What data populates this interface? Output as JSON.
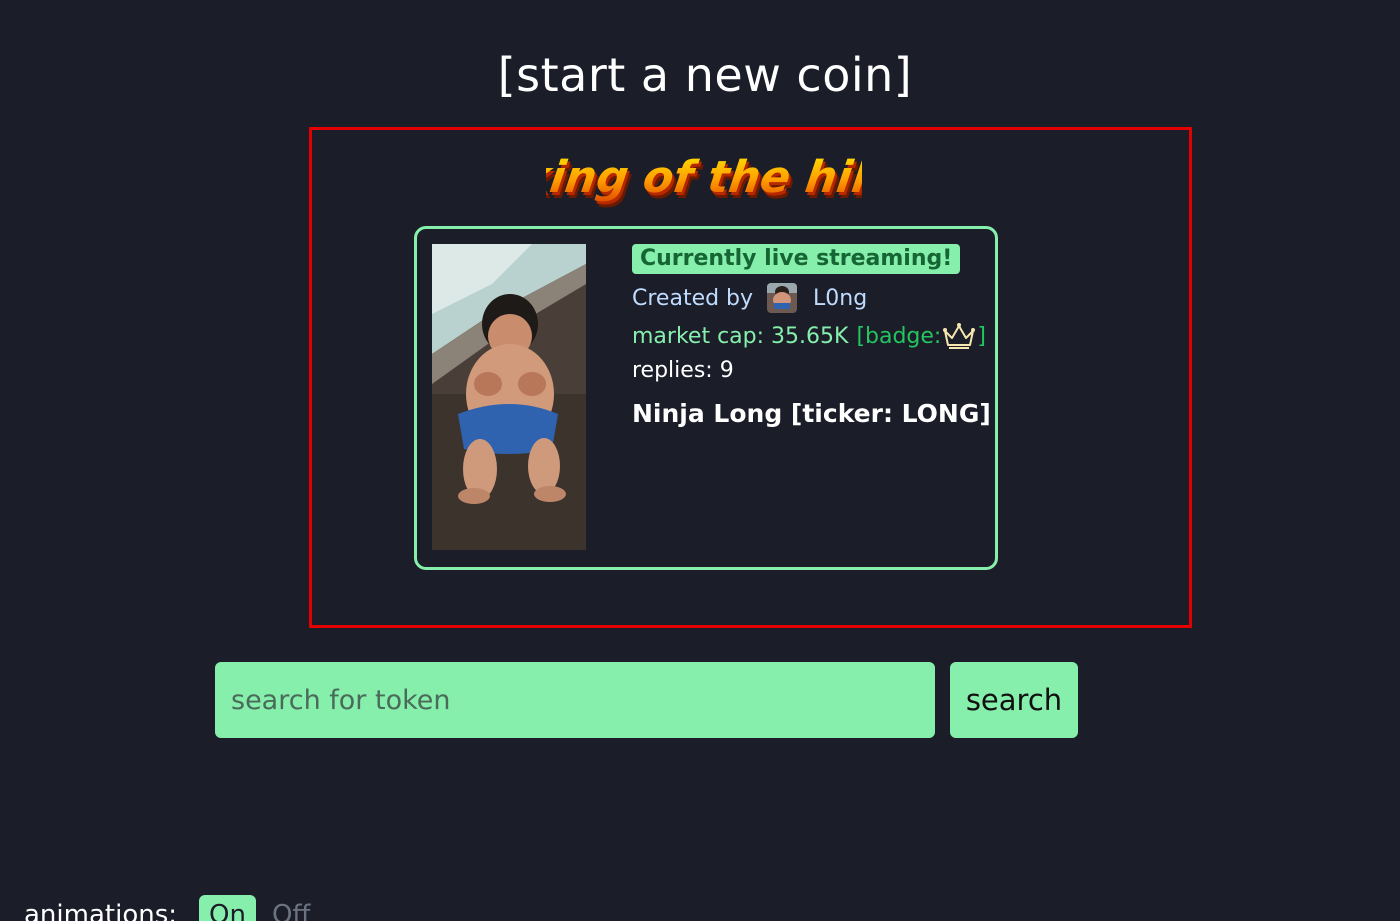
{
  "header": {
    "start_coin_label": "[start a new coin]"
  },
  "king_of_the_hill": {
    "logo_text": "king of the hill",
    "card": {
      "live_label": "Currently live streaming!",
      "created_by_label": "Created by",
      "creator_name": "L0ng",
      "market_cap": "market cap: 35.65K",
      "badge_open": "[badge:",
      "badge_close": "]",
      "badge_icon": "crown-icon",
      "replies": "replies: 9",
      "name": "Ninja Long [ticker: LONG]"
    }
  },
  "search": {
    "placeholder": "search for token",
    "button_label": "search"
  },
  "animation": {
    "label": "animations:",
    "on_label": "On",
    "off_label": "Off"
  },
  "colors": {
    "background": "#1b1d29",
    "accent_green": "#86efac",
    "highlight_border": "#e50000"
  }
}
